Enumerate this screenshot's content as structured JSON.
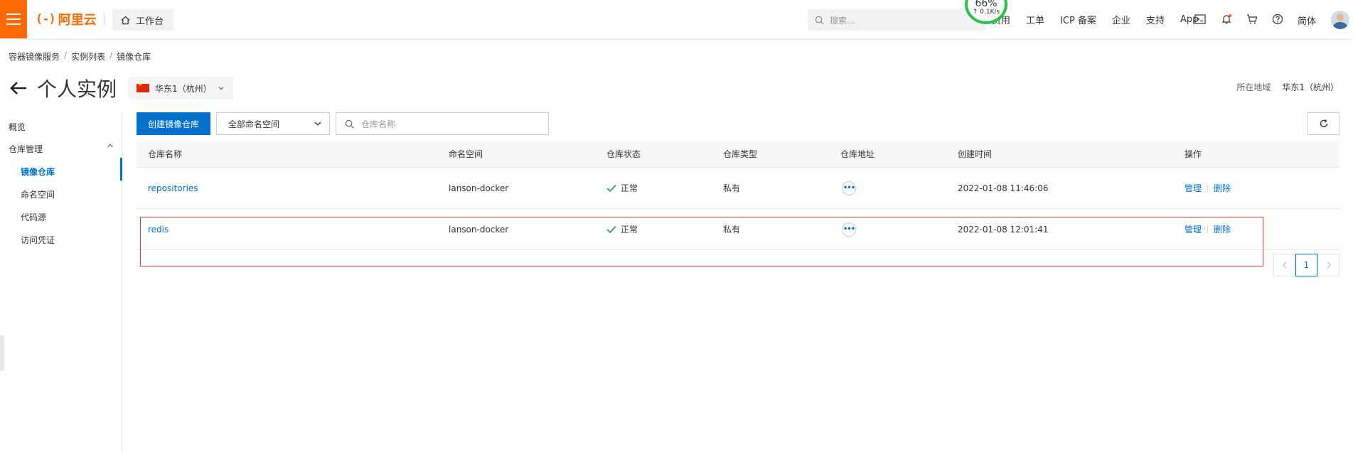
{
  "topbar": {
    "logo_text": "阿里云",
    "logo_mark": "(-)",
    "workbench_label": "工作台",
    "search_placeholder": "搜索...",
    "nav": [
      "费用",
      "工单",
      "ICP 备案",
      "企业",
      "支持",
      "App"
    ],
    "lang": "简体",
    "speed_percent": "66%",
    "speed_rate": "↑ 0.1K/s",
    "accent": "#ff6a00"
  },
  "breadcrumb": [
    "容器镜像服务",
    "实例列表",
    "镜像仓库"
  ],
  "page": {
    "title": "个人实例",
    "region": "华东1（杭州）",
    "region_label": "所在地域",
    "region_value": "华东1（杭州）"
  },
  "sidebar": {
    "overview": "概览",
    "repo_mgmt": "仓库管理",
    "items": [
      "镜像仓库",
      "命名空间",
      "代码源",
      "访问凭证"
    ],
    "active_index": 0
  },
  "toolbar": {
    "create_label": "创建镜像仓库",
    "namespace_select": "全部命名空间",
    "name_placeholder": "仓库名称"
  },
  "table": {
    "headers": [
      "仓库名称",
      "命名空间",
      "仓库状态",
      "仓库类型",
      "仓库地址",
      "创建时间",
      "操作"
    ],
    "rows": [
      {
        "name": "repositories",
        "namespace": "lanson-docker",
        "status": "正常",
        "type": "私有",
        "created": "2022-01-08 11:46:06",
        "op_manage": "管理",
        "op_delete": "删除"
      },
      {
        "name": "redis",
        "namespace": "lanson-docker",
        "status": "正常",
        "type": "私有",
        "created": "2022-01-08 12:01:41",
        "op_manage": "管理",
        "op_delete": "删除"
      }
    ]
  },
  "pagination": {
    "current": "1"
  },
  "colors": {
    "primary": "#0070cc",
    "success": "#27a844",
    "highlight": "#e53935"
  }
}
